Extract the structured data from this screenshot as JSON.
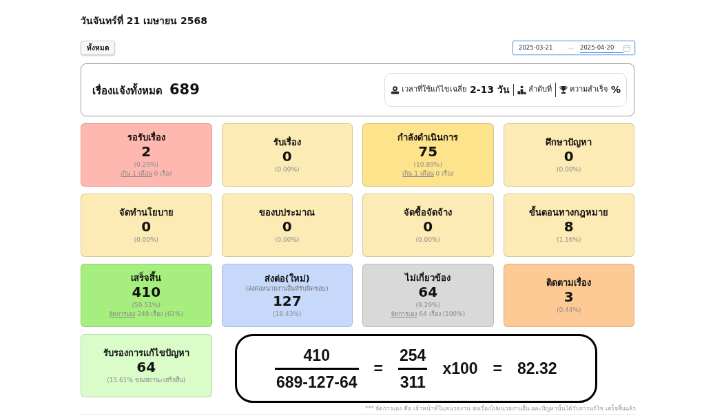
{
  "header": {
    "date": "วันจันทร์ที่ 21 เมษายน 2568"
  },
  "filter": {
    "button": "ทั้งหมด",
    "date_range": {
      "focused": true,
      "dates": [
        {
          "value": "2025-03-21",
          "selected": false
        },
        {
          "value": "2025-04-20",
          "selected": true
        }
      ]
    }
  },
  "summary": {
    "label": "เรื่องแจ้งทั้งหมด",
    "total": "689",
    "stats": [
      {
        "label": "เวลาที่ใช้แก้ไขเฉลี่ย",
        "value": "2-13 วัน"
      },
      {
        "label": "ลำดับที่"
      },
      {
        "label": "ความสำเร็จ",
        "value": "%"
      }
    ]
  },
  "cards": [
    {
      "title": "รอรับเรื่อง",
      "value": "2",
      "percent": "(0.29%)",
      "color": "#ffb8b0",
      "note": {
        "link": "เกิน 1 เดือน",
        "text": "0 เรื่อง"
      }
    },
    {
      "title": "รับเรื่อง",
      "value": "0",
      "percent": "(0.00%)",
      "color": "#fdebb5"
    },
    {
      "title": "กำลังดำเนินการ",
      "value": "75",
      "percent": "(10.89%)",
      "color": "#fde38c",
      "note": {
        "link": "เกิน 1 เดือน",
        "text": "0 เรื่อง"
      }
    },
    {
      "title": "ศึกษาปัญหา",
      "value": "0",
      "percent": "(0.00%)",
      "color": "#fdebb5"
    },
    {
      "title": "จัดทำนโยบาย",
      "value": "0",
      "percent": "(0.00%)",
      "color": "#fdebb5"
    },
    {
      "title": "ของบประมาณ",
      "value": "0",
      "percent": "(0.00%)",
      "color": "#fdebb5"
    },
    {
      "title": "จัดซื้อจัดจ้าง",
      "value": "0",
      "percent": "(0.00%)",
      "color": "#fdebb5"
    },
    {
      "title": "ขั้นตอนทางกฎหมาย",
      "value": "8",
      "percent": "(1.16%)",
      "color": "#fdebb5"
    },
    {
      "title": "เสร็จสิ้น",
      "value": "410",
      "percent": "(59.51%)",
      "color": "#a6ee7e",
      "note": {
        "link": "จัดการเอง",
        "text": "249 เรื่อง (61%)"
      }
    },
    {
      "title": "ส่งต่อ(ใหม่)",
      "subtitle": "(ส่งต่อหน่วยงานอื่นที่รับผิดชอบ)",
      "value": "127",
      "percent": "(18.43%)",
      "color": "#c6d9fb"
    },
    {
      "title": "ไม่เกี่ยวข้อง",
      "value": "64",
      "percent": "(9.29%)",
      "color": "#d9d9d9",
      "note": {
        "link": "จัดการเอง",
        "text": "64 เรื่อง (100%)"
      }
    },
    {
      "title": "ติดตามเรื่อง",
      "value": "3",
      "percent": "(0.44%)",
      "color": "#fdca95"
    },
    {
      "title": "รับรองการแก้ไขปัญหา",
      "value": "64",
      "percent": "(15.61% ของสถานะเสร็จสิ้น)",
      "color": "#dafcc8"
    }
  ],
  "formula": [
    {
      "kind": "fraction",
      "numerator": "410",
      "denominator": "689-127-64"
    },
    {
      "kind": "text",
      "text": "="
    },
    {
      "kind": "fraction",
      "numerator": "254",
      "denominator": "311"
    },
    {
      "kind": "text",
      "text": "x100"
    },
    {
      "kind": "text",
      "text": "="
    },
    {
      "kind": "text",
      "text": "82.32"
    }
  ],
  "footnote": "*** จัดการเอง คือ เจ้าหน้าที่ในหน่วยงาน ส่งเรื่องไปหน่วยงานอื่น และปัญหานั้นได้รับการแก้ไข เสร็จสิ้นแล้ว"
}
